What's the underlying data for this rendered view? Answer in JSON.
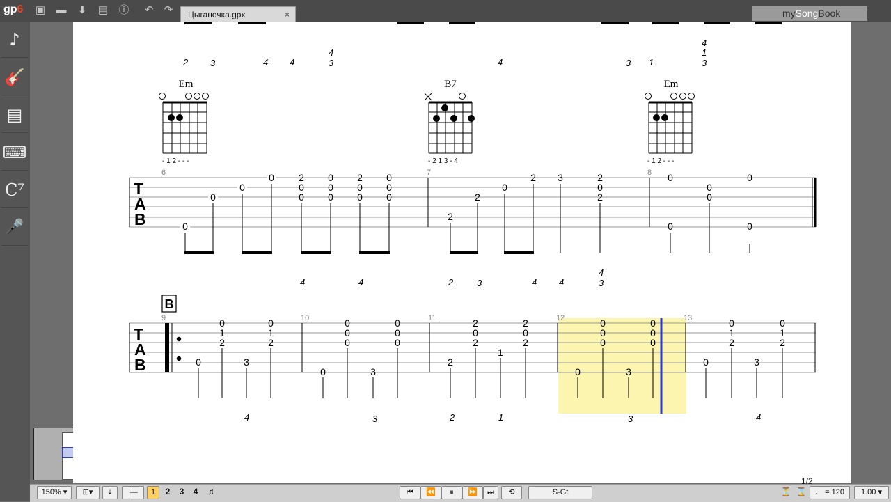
{
  "app": {
    "logo_main": "gp",
    "logo_ver": "6"
  },
  "toolbar": {
    "icons": [
      "new-file-icon",
      "open-folder-icon",
      "save-icon",
      "print-icon",
      "info-icon",
      "undo-icon",
      "redo-icon"
    ]
  },
  "tab": {
    "title": "Цыганочка.gpx",
    "close": "×"
  },
  "brand": {
    "my": "my",
    "song": "Song",
    "book": "Book"
  },
  "sidebar": {
    "items": [
      "♪",
      "🎸",
      "▤",
      "⌨",
      "C⁷",
      "🎤"
    ]
  },
  "score": {
    "section_mark": "B",
    "tab_clef": [
      "T",
      "A",
      "B"
    ],
    "top_fingering": [
      {
        "t": "2"
      },
      {
        "t": "3"
      },
      {
        "t": "4"
      },
      {
        "t": "4"
      },
      {
        "t": "4"
      },
      {
        "t": "3"
      },
      {
        "t": "4"
      },
      {
        "t": "3"
      },
      {
        "t": "1"
      },
      {
        "t": "4"
      },
      {
        "t": "1"
      },
      {
        "t": "3"
      }
    ],
    "chords": [
      {
        "name": "Em",
        "fingers": "- 1 2 - - -"
      },
      {
        "name": "B7",
        "fingers": "- 2 1 3 - 4"
      },
      {
        "name": "Em",
        "fingers": "- 1 2 - - -"
      }
    ],
    "measures_row1": [
      "6",
      "7",
      "8"
    ],
    "measures_row2": [
      "9",
      "10",
      "11",
      "12",
      "13"
    ],
    "mid_fingering": [
      "4",
      "4",
      "2",
      "3",
      "4",
      "4",
      "4",
      "3"
    ],
    "bottom_fingering": [
      "4",
      "3",
      "2",
      "1",
      "3",
      "4"
    ]
  },
  "controls": {
    "zoom": "150%",
    "voices": [
      "1",
      "2",
      "3",
      "4"
    ],
    "track": "S-Gt",
    "tempo": "= 120",
    "speed": "1.00",
    "page_counter": "1/2"
  },
  "colors": {
    "highlight": "#fbf5b0",
    "cursor": "#2a3ac8"
  }
}
